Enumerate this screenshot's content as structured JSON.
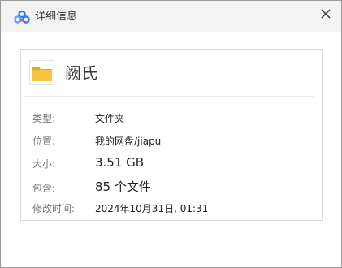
{
  "dialog": {
    "title": "详细信息",
    "icon": "baidu-netdisk-cloud-icon",
    "close_icon": "close-icon"
  },
  "item": {
    "name": "阙氏",
    "icon": "folder-icon"
  },
  "details": [
    {
      "label": "类型:",
      "value": "文件夹"
    },
    {
      "label": "位置:",
      "value": "我的网盘/jiapu"
    },
    {
      "label": "大小:",
      "value": "3.51 GB"
    },
    {
      "label": "包含:",
      "value": "85 个文件"
    },
    {
      "label": "修改时间:",
      "value": "2024年10月31日, 01:31"
    }
  ],
  "colors": {
    "folder": "#f5c542",
    "cloud_blue": "#2f7bf5",
    "cloud_red": "#f0522d",
    "titlebar": "#f3f3f3"
  }
}
